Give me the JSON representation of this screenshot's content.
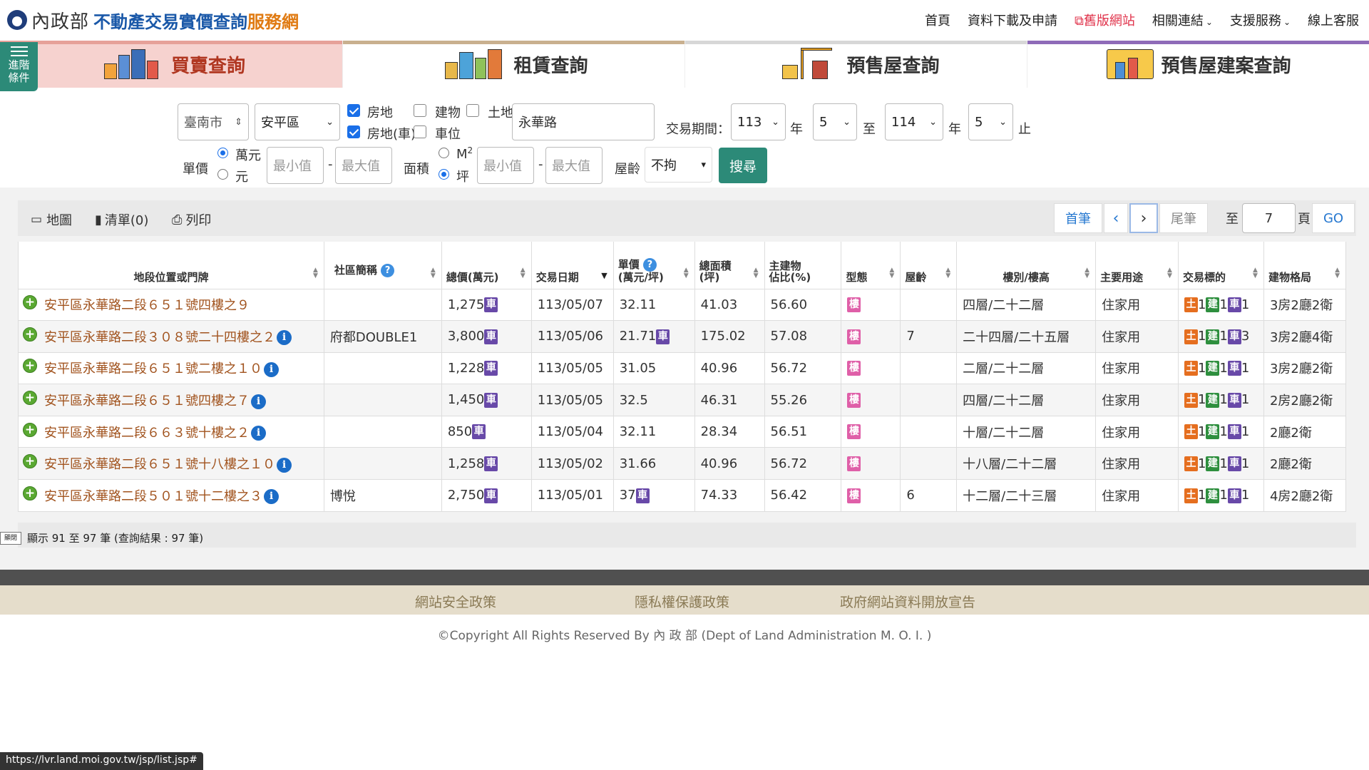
{
  "header": {
    "org": "內政部",
    "title_blue": "不動產交易實價查詢",
    "title_orange": "服務網",
    "nav": [
      "首頁",
      "資料下載及申請",
      "舊版網站",
      "相關連結",
      "支援服務",
      "線上客服"
    ]
  },
  "tabs": [
    {
      "label": "買賣查詢"
    },
    {
      "label": "租賃查詢"
    },
    {
      "label": "預售屋查詢"
    },
    {
      "label": "預售屋建案查詢"
    }
  ],
  "advanced": {
    "line1": "進階",
    "line2": "條件"
  },
  "filter": {
    "city": "臺南市",
    "district": "安平區",
    "road": "永華路",
    "chk_house_land": "房地",
    "chk_building": "建物",
    "chk_land": "土地",
    "chk_house_land_car": "房地(車)",
    "chk_parking": "車位",
    "period_label": "交易期間：",
    "year_from": "113",
    "month_from": "5",
    "year_to": "114",
    "month_to": "5",
    "year_unit": "年",
    "to": "至",
    "stop": "止",
    "price_label": "單價",
    "unit_wan": "萬元",
    "unit_yuan": "元",
    "min_ph": "最小值",
    "max_ph": "最大值",
    "dash": "-",
    "area_label": "面積",
    "unit_m2": "M",
    "unit_ping": "坪",
    "age_label": "屋齡",
    "age_value": "不拘",
    "search": "搜尋"
  },
  "toolbar": {
    "map": "地圖",
    "list": "清單(0)",
    "print": "列印",
    "first": "首筆",
    "prev": "‹",
    "next": "›",
    "last": "尾筆",
    "goto_label": "至",
    "page": "7",
    "page_unit": "頁",
    "go": "GO"
  },
  "columns": [
    "地段位置或門牌",
    "社區簡稱",
    "總價(萬元)",
    "交易日期",
    "單價",
    "(萬元/坪)",
    "總面積",
    "(坪)",
    "主建物",
    "佔比(%)",
    "型態",
    "屋齡",
    "樓別/樓高",
    "主要用途",
    "交易標的",
    "建物格局"
  ],
  "rows": [
    {
      "addr": "安平區永華路二段６５１號四樓之９",
      "community": "",
      "total": "1,275",
      "date": "113/05/07",
      "unit": "32.11",
      "area": "41.03",
      "main": "56.60",
      "age": "",
      "floor": "四層/二十二層",
      "use": "住家用",
      "t1": "1",
      "t2": "1",
      "t3": "1",
      "layout": "3房2廳2衛"
    },
    {
      "addr": "安平區永華路二段３０８號二十四樓之２",
      "community": "府都DOUBLE1",
      "total": "3,800",
      "date": "113/05/06",
      "unit": "21.71",
      "area": "175.02",
      "main": "57.08",
      "age": "7",
      "floor": "二十四層/二十五層",
      "use": "住家用",
      "t1": "1",
      "t2": "1",
      "t3": "3",
      "layout": "3房2廳4衛"
    },
    {
      "addr": "安平區永華路二段６５１號二樓之１０",
      "community": "",
      "total": "1,228",
      "date": "113/05/05",
      "unit": "31.05",
      "area": "40.96",
      "main": "56.72",
      "age": "",
      "floor": "二層/二十二層",
      "use": "住家用",
      "t1": "1",
      "t2": "1",
      "t3": "1",
      "layout": "3房2廳2衛"
    },
    {
      "addr": "安平區永華路二段６５１號四樓之７",
      "community": "",
      "total": "1,450",
      "date": "113/05/05",
      "unit": "32.5",
      "area": "46.31",
      "main": "55.26",
      "age": "",
      "floor": "四層/二十二層",
      "use": "住家用",
      "t1": "1",
      "t2": "1",
      "t3": "1",
      "layout": "2房2廳2衛"
    },
    {
      "addr": "安平區永華路二段６６３號十樓之２",
      "community": "",
      "total": "850",
      "date": "113/05/04",
      "unit": "32.11",
      "area": "28.34",
      "main": "56.51",
      "age": "",
      "floor": "十層/二十二層",
      "use": "住家用",
      "t1": "1",
      "t2": "1",
      "t3": "1",
      "layout": "2廳2衛"
    },
    {
      "addr": "安平區永華路二段６５１號十八樓之１０",
      "community": "",
      "total": "1,258",
      "date": "113/05/02",
      "unit": "31.66",
      "area": "40.96",
      "main": "56.72",
      "age": "",
      "floor": "十八層/二十二層",
      "use": "住家用",
      "t1": "1",
      "t2": "1",
      "t3": "1",
      "layout": "2廳2衛"
    },
    {
      "addr": "安平區永華路二段５０１號十二樓之３",
      "community": "博悅",
      "total": "2,750",
      "date": "113/05/01",
      "unit": "37",
      "area": "74.33",
      "main": "56.42",
      "age": "6",
      "floor": "十二層/二十三層",
      "use": "住家用",
      "t1": "1",
      "t2": "1",
      "t3": "1",
      "layout": "4房2廳2衛"
    }
  ],
  "badges": {
    "car": "車",
    "type": "樓",
    "land": "土",
    "bld": "建",
    "car2": "車"
  },
  "status": {
    "toggle": "顯閉",
    "text": "顯示 91 至 97 筆 (查詢結果 : 97 筆)"
  },
  "footer": {
    "links": [
      "網站安全政策",
      "隱私權保護政策",
      "政府網站資料開放宣告"
    ],
    "copy": "©Copyright All Rights Reserved By 內 政 部 (Dept of Land Administration M. O. I. )",
    "url": "https://lvr.land.moi.gov.tw/jsp/list.jsp#"
  }
}
